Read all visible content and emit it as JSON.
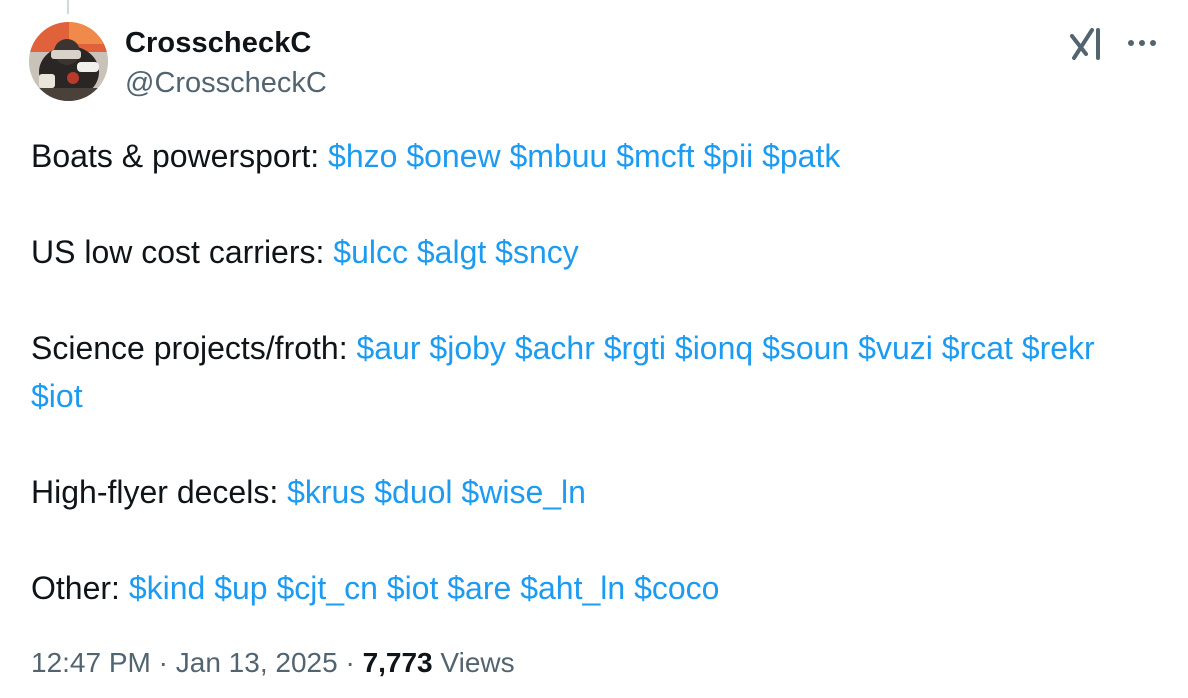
{
  "author": {
    "display_name": "CrosscheckC",
    "handle": "@CrosscheckC"
  },
  "icons": {
    "avatar": "avatar-photo",
    "grok": "grok-icon",
    "more": "more-options-icon"
  },
  "colors": {
    "link": "#1d9bf0",
    "text": "#0f1419",
    "secondary": "#536471"
  },
  "tweet": {
    "paragraphs": [
      {
        "label": "Boats & powersport:",
        "tags": [
          "$hzo",
          "$onew",
          "$mbuu",
          "$mcft",
          "$pii",
          "$patk"
        ]
      },
      {
        "label": "US low cost carriers:",
        "tags": [
          "$ulcc",
          "$algt",
          "$sncy"
        ]
      },
      {
        "label": "Science projects/froth:",
        "tags": [
          "$aur",
          "$joby",
          "$achr",
          "$rgti",
          "$ionq",
          "$soun",
          "$vuzi",
          "$rcat",
          "$rekr",
          "$iot"
        ]
      },
      {
        "label": "High-flyer decels:",
        "tags": [
          "$krus",
          "$duol",
          "$wise_ln"
        ]
      },
      {
        "label": "Other:",
        "tags": [
          "$kind",
          "$up",
          "$cjt_cn",
          "$iot",
          "$are",
          "$aht_ln",
          "$coco"
        ]
      }
    ]
  },
  "meta": {
    "time": "12:47 PM",
    "separator": "·",
    "date": "Jan 13, 2025",
    "views_count": "7,773",
    "views_label": "Views"
  }
}
